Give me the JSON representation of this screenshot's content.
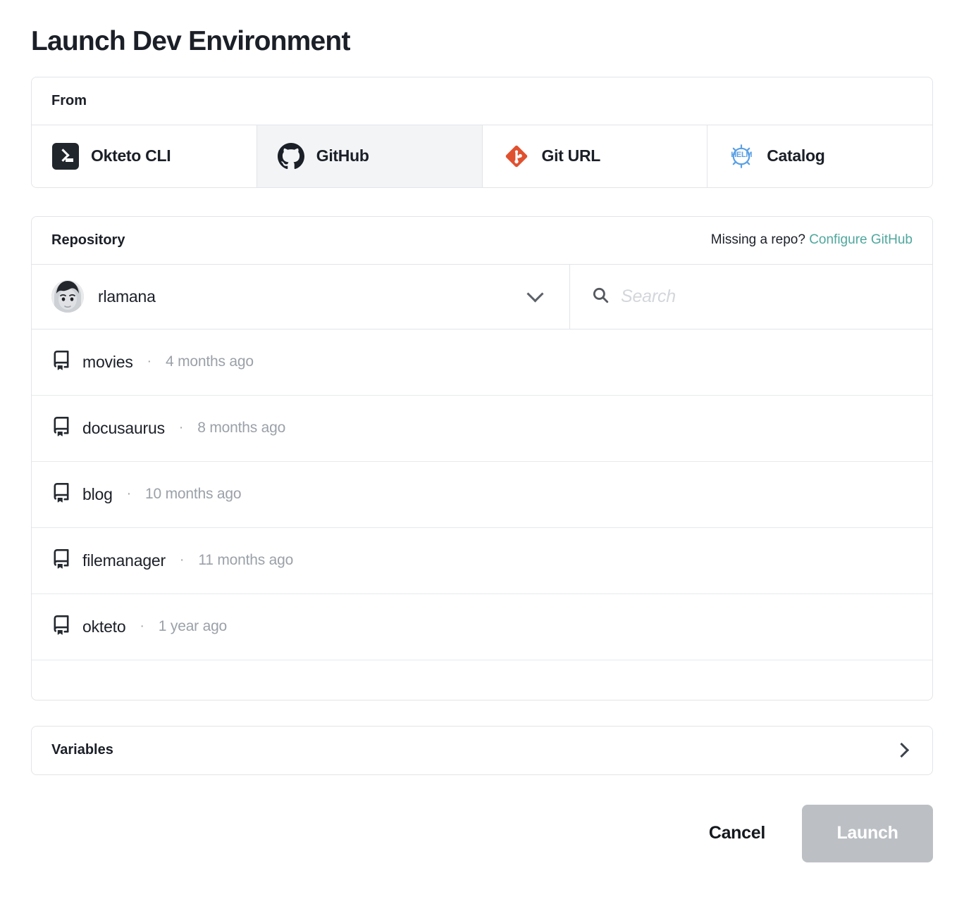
{
  "page_title": "Launch Dev Environment",
  "from_section": {
    "label": "From",
    "tabs": [
      {
        "label": "Okteto CLI",
        "icon": "terminal-icon",
        "selected": false
      },
      {
        "label": "GitHub",
        "icon": "github-icon",
        "selected": true
      },
      {
        "label": "Git URL",
        "icon": "git-icon",
        "selected": false
      },
      {
        "label": "Catalog",
        "icon": "helm-icon",
        "selected": false
      }
    ]
  },
  "repository_section": {
    "title": "Repository",
    "missing_repo_text": "Missing a repo?",
    "configure_link": "Configure GitHub",
    "owner": "rlamana",
    "search_placeholder": "Search",
    "search_value": "",
    "repos": [
      {
        "name": "movies",
        "separator": "·",
        "updated": "4 months ago"
      },
      {
        "name": "docusaurus",
        "separator": "·",
        "updated": "8 months ago"
      },
      {
        "name": "blog",
        "separator": "·",
        "updated": "10 months ago"
      },
      {
        "name": "filemanager",
        "separator": "·",
        "updated": "11 months ago"
      },
      {
        "name": "okteto",
        "separator": "·",
        "updated": "1 year ago"
      }
    ]
  },
  "variables_section": {
    "label": "Variables"
  },
  "footer": {
    "cancel_label": "Cancel",
    "launch_label": "Launch"
  },
  "colors": {
    "text": "#1b1f27",
    "link_teal": "#4fa79d",
    "muted": "#9ba1a8",
    "selected_tab_bg": "#f3f4f6",
    "git_orange": "#e0512f",
    "helm_blue": "#5aa0e5",
    "launch_disabled": "#bcc0c4",
    "border": "#e2e4e8"
  },
  "helm_icon_text": "HELM"
}
